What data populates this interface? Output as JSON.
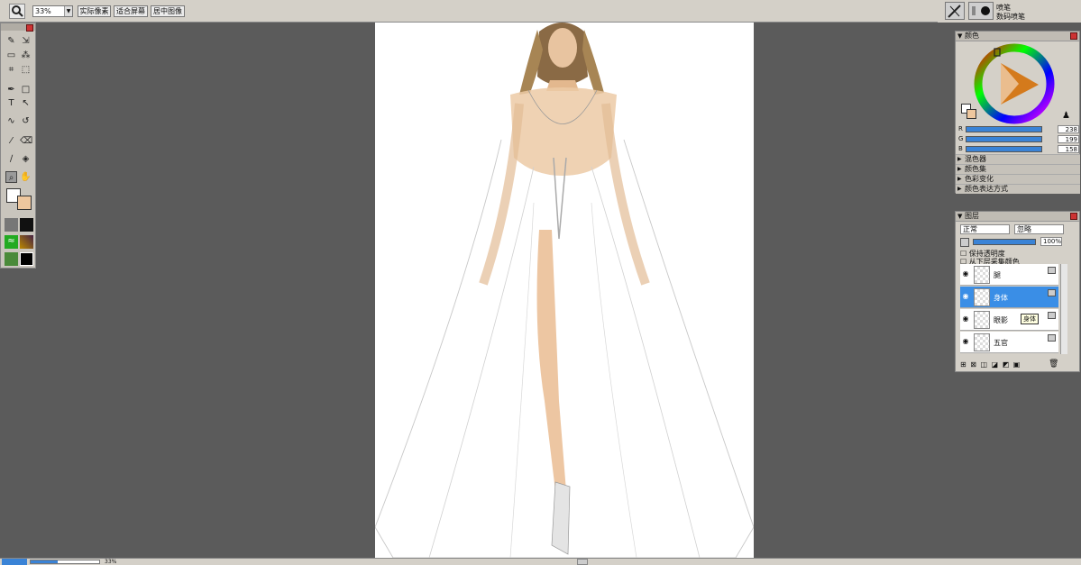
{
  "toolbar": {
    "zoom_value": "33%",
    "btn_actual": "实际像素",
    "btn_fit": "适合屏幕",
    "btn_center": "居中图像"
  },
  "brush": {
    "name": "喷笔",
    "preset": "数码喷笔"
  },
  "color_panel": {
    "title": "颜色",
    "r_label": "R",
    "g_label": "G",
    "b_label": "B",
    "r": "238",
    "g": "199",
    "b": "158",
    "fg_color": "#eec79e",
    "subpanels": [
      "混色器",
      "颜色集",
      "色彩变化",
      "颜色表达方式"
    ]
  },
  "layers_panel": {
    "title": "图层",
    "blend_mode": "正常",
    "blend_mode2": "忽略",
    "opacity": "100%",
    "preserve_transparency": "保持透明度",
    "pick_from_below": "从下层采集颜色",
    "tooltip": "身体",
    "layers": [
      {
        "name": "腿",
        "active": false
      },
      {
        "name": "身体",
        "active": true
      },
      {
        "name": "眼影",
        "active": false
      },
      {
        "name": "五官",
        "active": false
      }
    ]
  },
  "status": {
    "zoom": "33%"
  },
  "colors": {
    "accent": "#3a8ee6",
    "bg": "#5b5b5b",
    "chrome": "#d4d0c8"
  }
}
